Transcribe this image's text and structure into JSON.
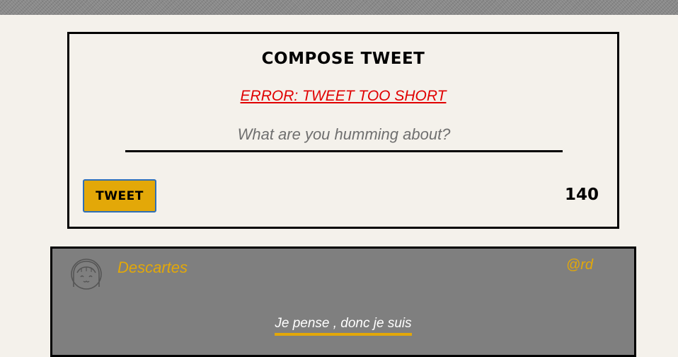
{
  "compose": {
    "title": "Compose Tweet",
    "error": "ERROR: TWEET TOO SHORT",
    "placeholder": "What are you humming about?",
    "button_label": "Tweet",
    "counter": "140"
  },
  "tweet": {
    "author": "Descartes",
    "handle": "@rd",
    "text": "Je pense , donc je suis",
    "avatar_icon": "girl-avatar-icon"
  },
  "colors": {
    "accent": "#e3a808",
    "error": "#e00000",
    "card_background": "#7f7f7f",
    "page_background": "#f4f1eb"
  }
}
